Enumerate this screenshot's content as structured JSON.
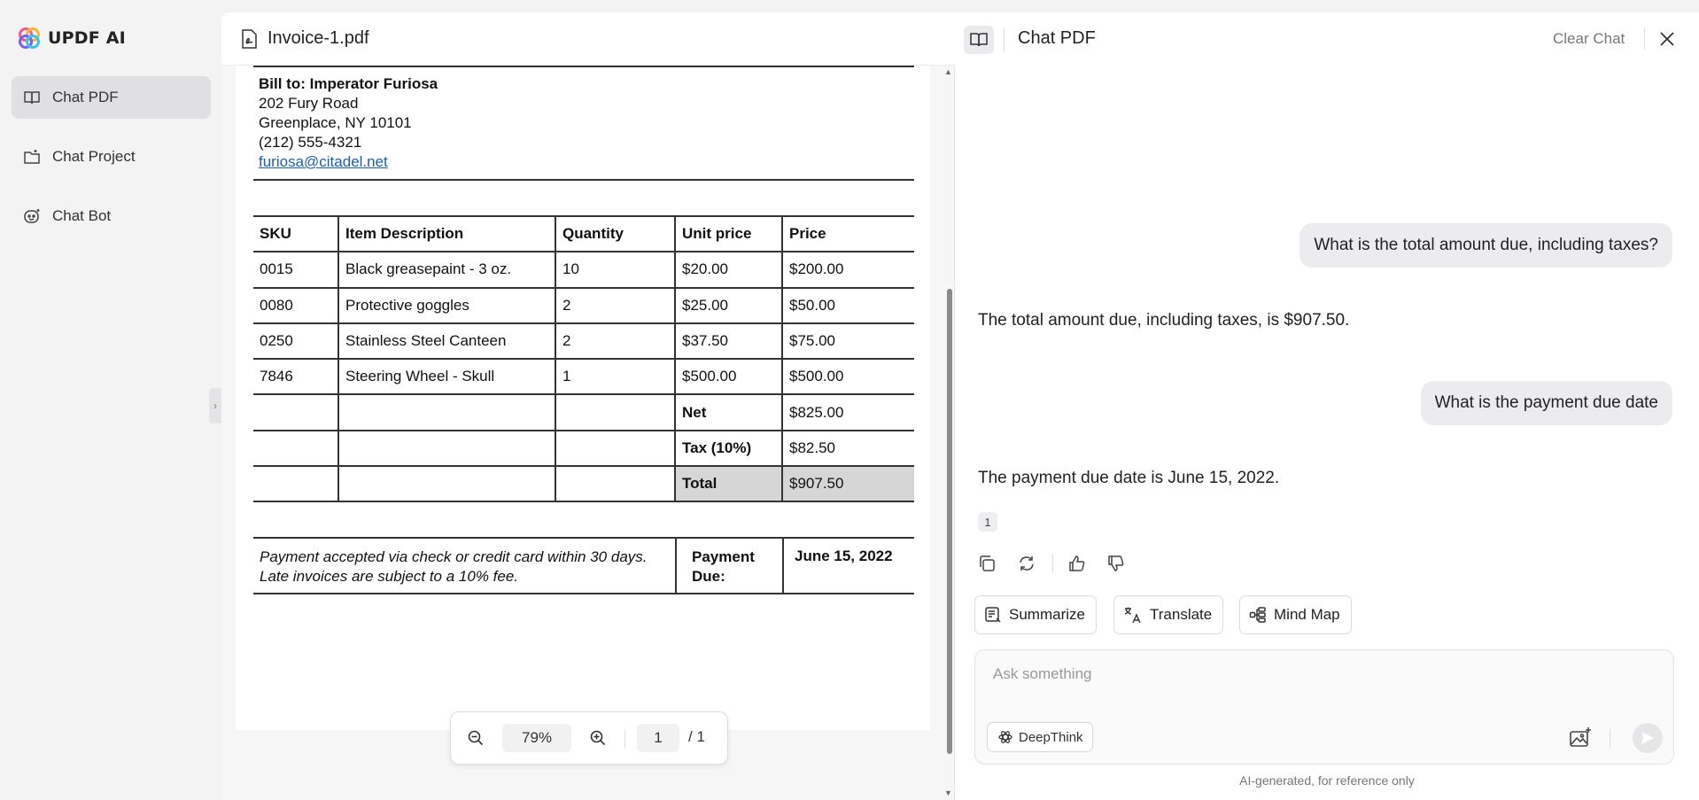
{
  "app": {
    "name": "UPDF AI"
  },
  "sidebar": {
    "items": [
      {
        "label": "Chat PDF",
        "icon": "book-icon",
        "active": true
      },
      {
        "label": "Chat Project",
        "icon": "folder-icon",
        "active": false
      },
      {
        "label": "Chat Bot",
        "icon": "bot-icon",
        "active": false
      }
    ]
  },
  "pdf": {
    "file_name": "Invoice-1.pdf",
    "bill_to": {
      "heading": "Bill to: Imperator Furiosa",
      "address1": "202 Fury Road",
      "address2": "Greenplace, NY 10101",
      "phone": "(212) 555-4321",
      "email": "furiosa@citadel.net"
    },
    "table": {
      "headers": [
        "SKU",
        "Item Description",
        "Quantity",
        "Unit price",
        "Price"
      ],
      "rows": [
        [
          "0015",
          "Black greasepaint - 3 oz.",
          "10",
          "$20.00",
          "$200.00"
        ],
        [
          "0080",
          "Protective goggles",
          "2",
          "$25.00",
          "$50.00"
        ],
        [
          "0250",
          "Stainless Steel Canteen",
          "2",
          "$37.50",
          "$75.00"
        ],
        [
          "7846",
          "Steering Wheel - Skull",
          "1",
          "$500.00",
          "$500.00"
        ]
      ],
      "net_label": "Net",
      "net_value": "$825.00",
      "tax_label": "Tax (10%)",
      "tax_value": "$82.50",
      "total_label": "Total",
      "total_value": "$907.50"
    },
    "terms": {
      "text": "Payment accepted via check or credit card within 30 days. Late invoices are subject to a 10% fee.",
      "due_label_1": "Payment",
      "due_label_2": "Due:",
      "due_date": "June 15, 2022"
    },
    "zoom": {
      "level": "79%",
      "page": "1",
      "total": "/ 1"
    }
  },
  "chat": {
    "title": "Chat PDF",
    "clear_label": "Clear Chat",
    "messages": [
      {
        "role": "user",
        "text": "What is the total amount due, including taxes?"
      },
      {
        "role": "ai",
        "text": "The total amount due, including taxes, is $907.50."
      },
      {
        "role": "user",
        "text": "What is the payment due date"
      },
      {
        "role": "ai",
        "text": "The payment due date is June 15, 2022."
      }
    ],
    "reference": "1",
    "chips": [
      "Summarize",
      "Translate",
      "Mind Map"
    ],
    "input_placeholder": "Ask something",
    "deepthink_label": "DeepThink",
    "disclaimer": "AI-generated, for reference only"
  },
  "colors": {
    "accent_link": "#1a5fb4",
    "total_cell": "#d6d6d6",
    "bubble": "#ececee"
  }
}
